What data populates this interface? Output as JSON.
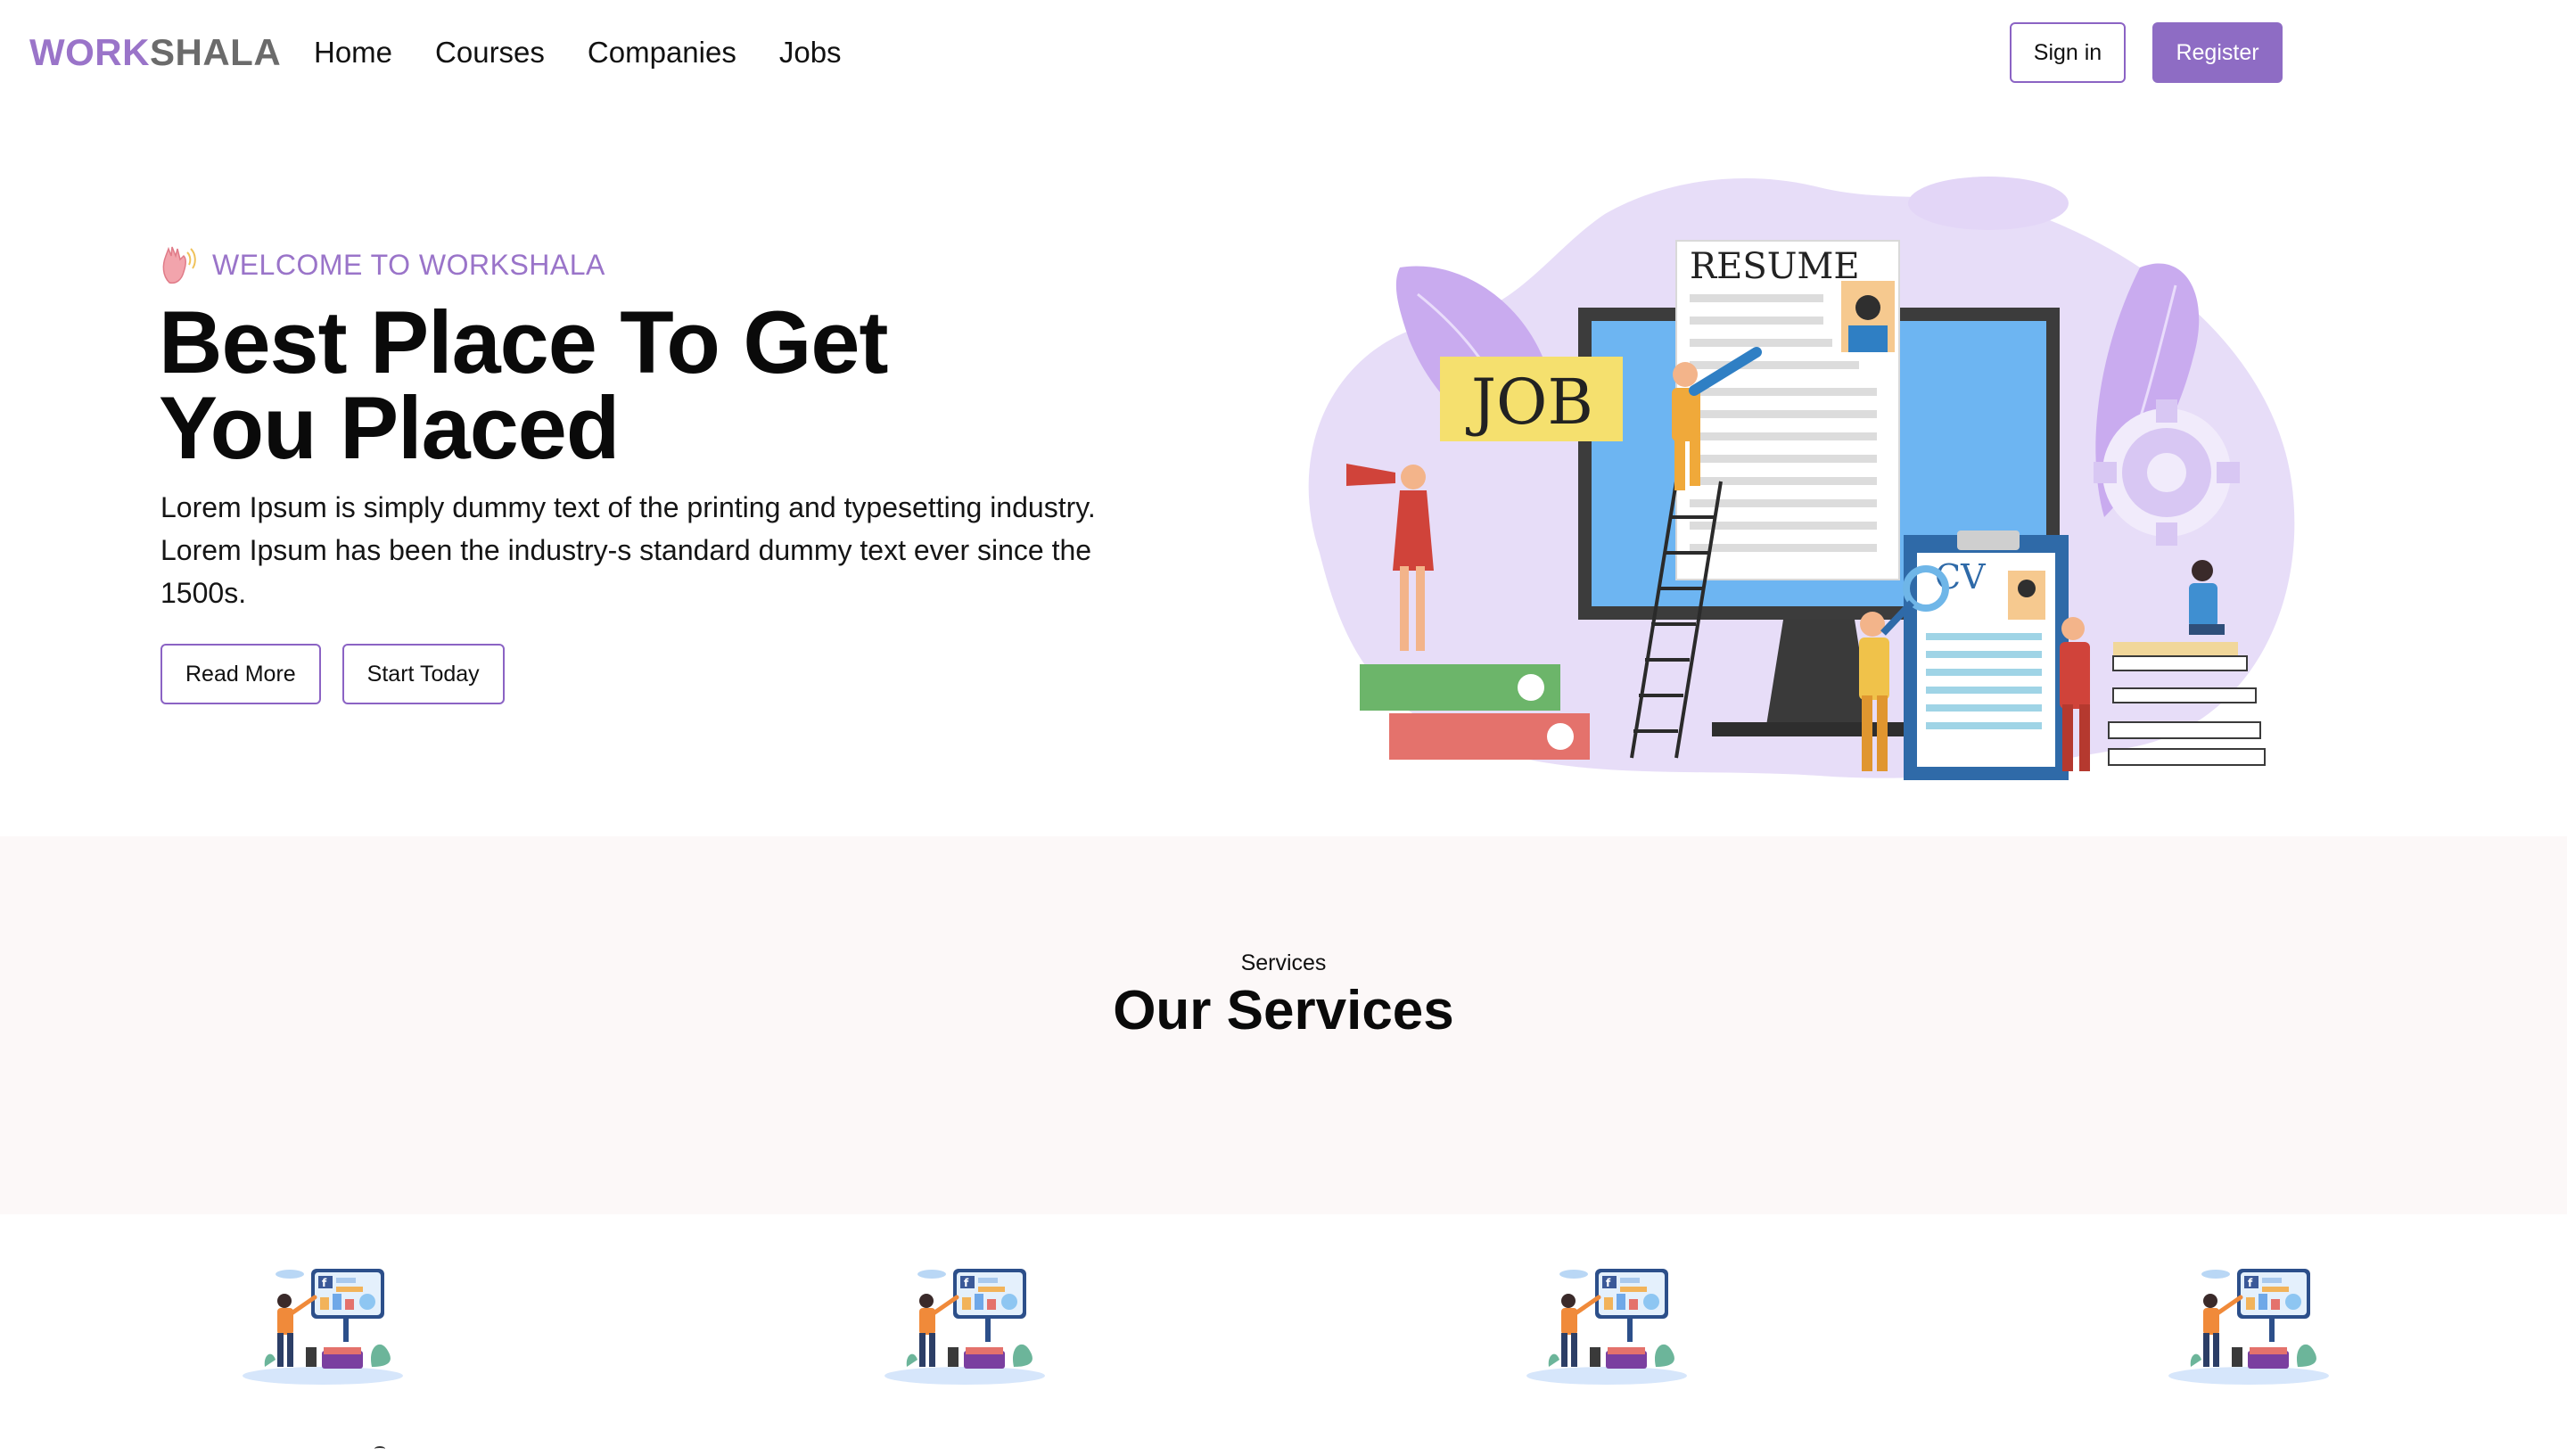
{
  "brand": {
    "logo_part1": "WORK",
    "logo_part2": "SHALA",
    "accent_color": "#9a74c9",
    "secondary_color": "#6b6b6b"
  },
  "nav": {
    "links": [
      "Home",
      "Courses",
      "Companies",
      "Jobs"
    ],
    "signin_label": "Sign in",
    "register_label": "Register"
  },
  "hero": {
    "kicker_icon": "hand-wave-icon",
    "kicker": "WELCOME TO WORKSHALA",
    "title_line1": "Best Place To Get",
    "title_line2": "You Placed",
    "description": "Lorem Ipsum is simply dummy text of the printing and typesetting industry. Lorem Ipsum has been the industry-s standard dummy text ever since the 1500s.",
    "read_more_label": "Read More",
    "start_today_label": "Start Today",
    "illustration": {
      "job_label": "JOB",
      "resume_label": "RESUME",
      "cv_label": "CV"
    }
  },
  "services": {
    "kicker": "Services",
    "title": "Our Services",
    "card_icon": "social-media-marketing-illustration",
    "band_color": "#fcf8f8"
  }
}
